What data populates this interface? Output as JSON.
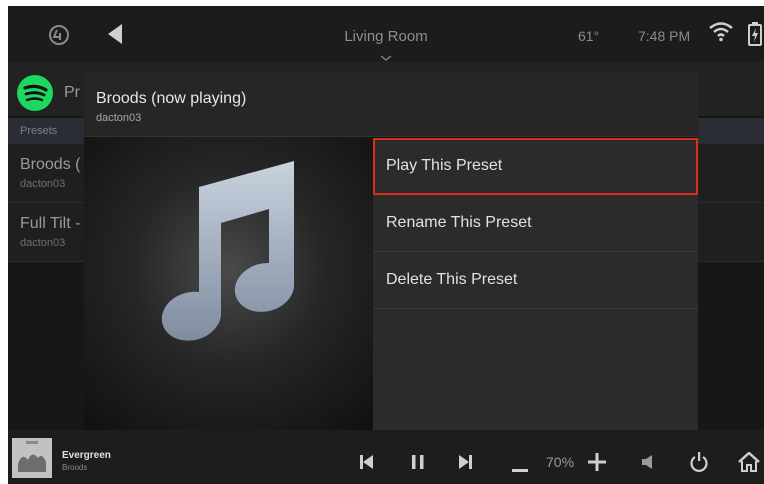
{
  "topbar": {
    "room": "Living Room",
    "temperature": "61°",
    "time": "7:48 PM"
  },
  "source": {
    "header_label": "Pr"
  },
  "presets_section": {
    "label": "Presets",
    "items": [
      {
        "title": "Broods (",
        "subtitle": "dacton03"
      },
      {
        "title": "Full Tilt -",
        "subtitle": "dacton03"
      }
    ]
  },
  "dialog": {
    "title": "Broods (now playing)",
    "subtitle": "dacton03",
    "menu": [
      {
        "label": "Play This Preset",
        "selected": true
      },
      {
        "label": "Rename This Preset",
        "selected": false
      },
      {
        "label": "Delete This Preset",
        "selected": false
      }
    ],
    "highlight_color": "#d9301e"
  },
  "now_playing": {
    "song": "Evergreen",
    "artist": "Broods",
    "volume": "70%"
  },
  "colors": {
    "spotify_green": "#1ed760",
    "background": "#171717"
  }
}
